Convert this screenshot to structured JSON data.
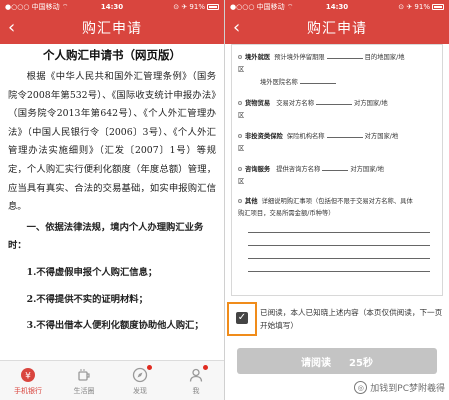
{
  "status_bar": {
    "carrier": "●○○○ 中国移动 ⌔",
    "time": "14:30",
    "battery_text": "⊙ ✈ 91%"
  },
  "left": {
    "nav": {
      "back": "‹",
      "title": "购汇申请"
    },
    "doc": {
      "title": "个人购汇申请书（网页版）",
      "body": "根据《中华人民共和国外汇管理条例》（国务院令2008年第532号）、《国际收支统计申报办法》（国务院令2013年第642号）、《个人外汇管理办法》（中国人民银行令〔2006〕3号）、《个人外汇管理办法实施细则》（汇发〔2007〕1号）等规定，个人购汇实行便利化额度（年度总额）管理，应当具有真实、合法的交易基础，如实申报购汇信息。",
      "section": "一、依据法律法规，境内个人办理购汇业务时：",
      "items": [
        "1.不得虚假申报个人购汇信息；",
        "2.不得提供不实的证明材料；",
        "3.不得出借本人便利化额度协助他人购汇；"
      ]
    },
    "tabs": [
      {
        "label": "手机银行",
        "icon": "bank-icon",
        "active": true
      },
      {
        "label": "生活圈",
        "icon": "coffee-icon",
        "active": false
      },
      {
        "label": "发现",
        "icon": "compass-icon",
        "active": false,
        "badge": true
      },
      {
        "label": "我",
        "icon": "user-icon",
        "active": false,
        "badge": true
      }
    ]
  },
  "right": {
    "nav": {
      "back": "‹",
      "title": "购汇申请"
    },
    "form": {
      "study": {
        "label": "境外就医",
        "text1": "预计境外停留期限",
        "text2": "目的地国家/地",
        "text3": "区",
        "text4": "境外医院名称"
      },
      "trade": {
        "label": "货物贸易",
        "text1": "交易对方名称",
        "text2": "对方国家/地",
        "text3": "区"
      },
      "insurance": {
        "label": "非投资类保险",
        "text1": "保险机构名称",
        "text2": "对方国家/地",
        "text3": "区"
      },
      "consult": {
        "label": "咨询服务",
        "text1": "提供咨询方名称",
        "text2": "对方国家/地",
        "text3": "区"
      },
      "other": {
        "label": "其他",
        "text1": "详细说明购汇事项（包括但不限于交易对方名称、具体",
        "text2": "购汇项目，交易所需金额/币种等）"
      }
    },
    "agree_text": "已阅读，本人已知晓上述内容（本页仅供阅读，下一页开始填写）",
    "checkbox_mark": "✓",
    "read_button": {
      "label": "请阅读",
      "countdown": "25秒"
    },
    "watermark": {
      "icon_text": "◎",
      "text": "加钱到PC梦附羲得"
    }
  }
}
